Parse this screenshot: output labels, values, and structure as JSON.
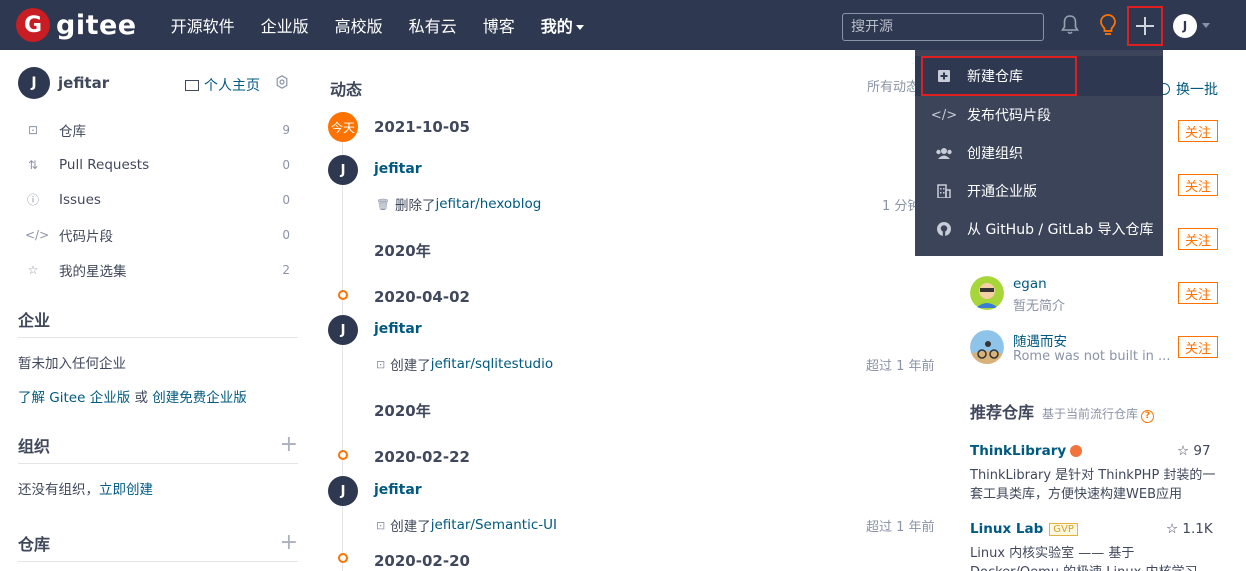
{
  "nav": {
    "logo_letter": "G",
    "logo_text": "gitee",
    "links": [
      "开源软件",
      "企业版",
      "高校版",
      "私有云",
      "博客"
    ],
    "mine": "我的",
    "search_placeholder": "搜开源",
    "avatar_letter": "J"
  },
  "dropdown": {
    "items": [
      {
        "label": "新建仓库",
        "icon": "plus-square-icon"
      },
      {
        "label": "发布代码片段",
        "icon": "code-icon"
      },
      {
        "label": "创建组织",
        "icon": "group-icon"
      },
      {
        "label": "开通企业版",
        "icon": "building-icon"
      },
      {
        "label": "从 GitHub / GitLab 导入仓库",
        "icon": "github-icon"
      }
    ]
  },
  "sidebar": {
    "avatar_letter": "J",
    "username": "jefitar",
    "homepage": "个人主页",
    "items": [
      {
        "label": "仓库",
        "count": "9"
      },
      {
        "label": "Pull Requests",
        "count": "0"
      },
      {
        "label": "Issues",
        "count": "0"
      },
      {
        "label": "代码片段",
        "count": "0"
      },
      {
        "label": "我的星选集",
        "count": "2"
      }
    ],
    "enterprise_title": "企业",
    "enterprise_none": "暂未加入任何企业",
    "enterprise_learn": "了解 Gitee 企业版",
    "enterprise_or": " 或 ",
    "enterprise_create": "创建免费企业版",
    "org_title": "组织",
    "org_none": "还没有组织，",
    "org_create": "立即创建",
    "repo_title": "仓库"
  },
  "timeline": {
    "title": "动态",
    "filter": "所有动态",
    "today": "今天",
    "entries": [
      {
        "date": "2021-10-05",
        "user": "jefitar",
        "action": "删除了 ",
        "repo": "jefitar/hexoblog",
        "time": "1 分钟"
      },
      {
        "year": "2020年",
        "date": "2020-04-02",
        "user": "jefitar",
        "action": "创建了 ",
        "repo": "jefitar/sqlitestudio",
        "time": "超过 1 年前"
      },
      {
        "year": "2020年",
        "date": "2020-02-22",
        "user": "jefitar",
        "action": "创建了 ",
        "repo": "jefitar/Semantic-UI",
        "time": "超过 1 年前"
      },
      {
        "date": "2020-02-20"
      }
    ]
  },
  "right": {
    "swap": "换一批",
    "follow": "关注",
    "users": [
      {
        "name": "egan",
        "desc": "暂无简介"
      },
      {
        "name": "随遇而安",
        "desc": "Rome was not built in ..."
      }
    ],
    "rec_title": "推荐仓库",
    "rec_sub": "基于当前流行仓库",
    "repos": [
      {
        "name": "ThinkLibrary",
        "stars": "97",
        "desc": "ThinkLibrary 是针对 ThinkPHP 封装的一套工具类库，方便快速构建WEB应用"
      },
      {
        "name": "Linux Lab",
        "badge": "GVP",
        "stars": "1.1K",
        "desc": "Linux 内核实验室 —— 基于 Docker/Qemu 的极速 Linux 内核学习"
      }
    ]
  },
  "colors": {
    "nav_bg": "#2e3850",
    "accent": "#fe7300",
    "link": "#005980",
    "highlight": "#e02020"
  }
}
